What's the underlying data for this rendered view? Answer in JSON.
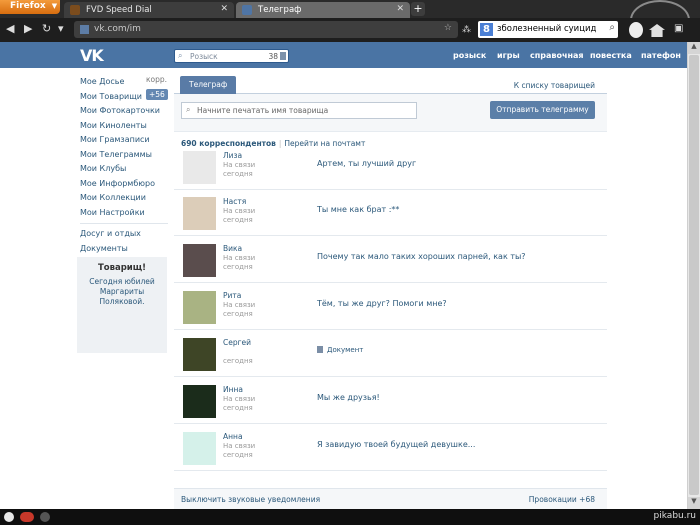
{
  "browser": {
    "menu_label": "Firefox",
    "tabs": [
      {
        "title": "FVD Speed Dial"
      },
      {
        "title": "Телеграф"
      }
    ],
    "new_tab": "+",
    "url": "vk.com/im",
    "search_value": "зболезненный суицид",
    "search_engine_letter": "8"
  },
  "vk": {
    "logo": "VK",
    "search": {
      "placeholder": "Розыск",
      "count": "38"
    },
    "topnav": [
      "розыск",
      "игры",
      "справочная",
      "повестка",
      "патефон"
    ]
  },
  "leftnav": {
    "items": [
      "Мое Досье",
      "Мои Товарищи",
      "Мои Фотокарточки",
      "Мои Киноленты",
      "Мои Грамзаписи",
      "Мои Телеграммы",
      "Мои Клубы",
      "Мое Информбюро",
      "Мои Коллекции",
      "Мои Настройки"
    ],
    "extra": [
      "Досуг и отдых",
      "Документы"
    ],
    "korr_label": "корр.",
    "badge": "+56"
  },
  "tovarisch_box": {
    "title": "Товарищ!",
    "text_1": "Сегодня юбилей",
    "text_2": "Маргариты",
    "text_3": "Поляковой."
  },
  "main": {
    "tab_label": "Телеграф",
    "to_list": "К списку товарищей",
    "input_placeholder": "Начните печатать имя товарища",
    "send_button": "Отправить телеграмму",
    "count_label": "690 корреспондентов",
    "count_link": "Перейти на почтамт"
  },
  "dialogs": [
    {
      "name": "Лиза",
      "status": "На связи",
      "date": "сегодня",
      "message": "Артем, ты лучший друг",
      "avatar_color": "#e9e9e9"
    },
    {
      "name": "Настя",
      "status": "На связи",
      "date": "сегодня",
      "message": "Ты мне как брат :**",
      "avatar_color": "#dccdb9"
    },
    {
      "name": "Вика",
      "status": "На связи",
      "date": "сегодня",
      "message": "Почему так мало таких хороших парней, как ты?",
      "avatar_color": "#5a4d4d"
    },
    {
      "name": "Рита",
      "status": "На связи",
      "date": "сегодня",
      "message": "Тём, ты же друг? Помоги мне?",
      "avatar_color": "#a9b383"
    },
    {
      "name": "Сергей",
      "status": "",
      "date": "сегодня",
      "message": "Документ",
      "avatar_color": "#3e4526",
      "is_doc": true
    },
    {
      "name": "Инна",
      "status": "На связи",
      "date": "сегодня",
      "message": "Мы же друзья!",
      "avatar_color": "#1b2c1b"
    },
    {
      "name": "Анна",
      "status": "На связи",
      "date": "сегодня",
      "message": "Я завидую твоей будущей девушке...",
      "avatar_color": "#d5f1ea"
    }
  ],
  "footer": {
    "left": "Выключить звуковые уведомления",
    "right": "Провокации +68"
  },
  "taskbar": {
    "watermark": "pikabu.ru"
  }
}
